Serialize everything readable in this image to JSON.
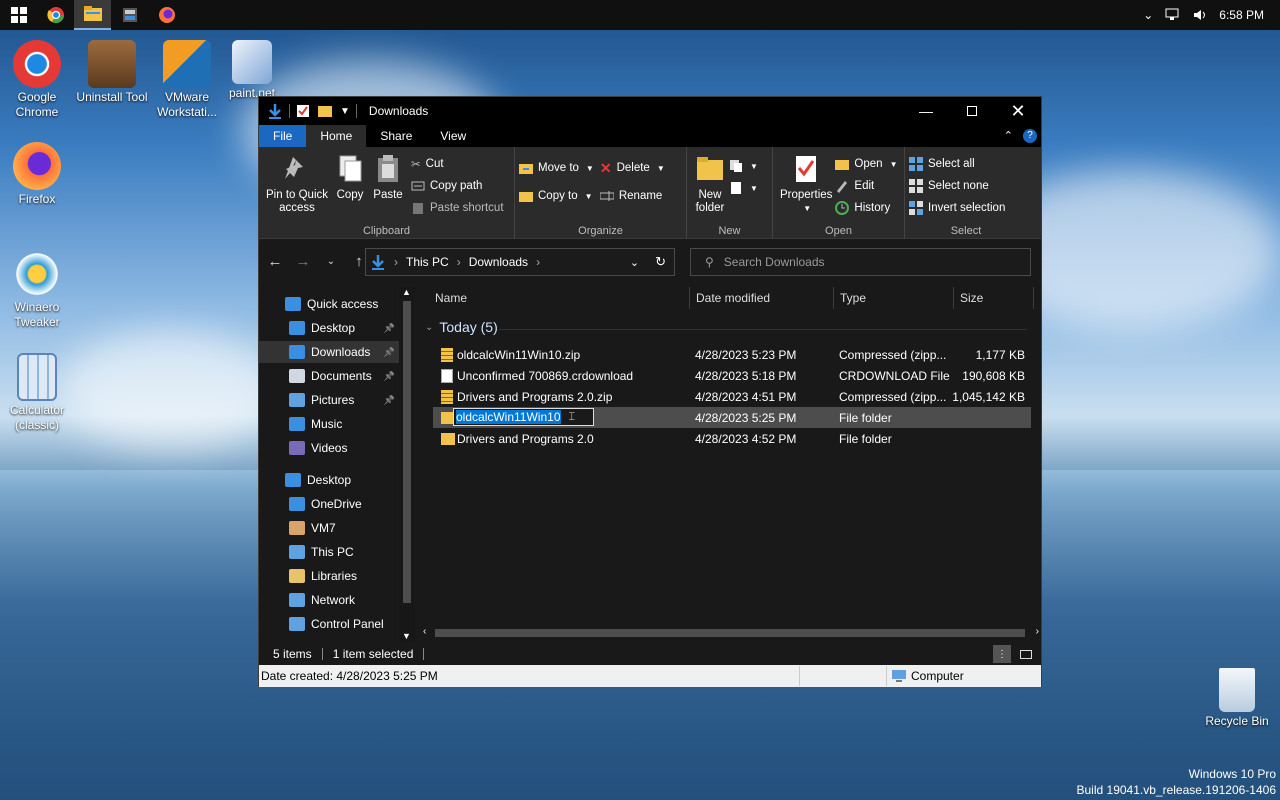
{
  "taskbar": {
    "apps": [
      {
        "name": "windows-start",
        "active": false
      },
      {
        "name": "chrome",
        "active": false
      },
      {
        "name": "file-explorer",
        "active": true
      },
      {
        "name": "uninstall-tool",
        "active": false
      },
      {
        "name": "firefox",
        "active": false
      }
    ],
    "clock": "6:58 PM"
  },
  "desktop": {
    "icons": [
      {
        "label": "Google\nChrome",
        "icon": "chrome-icon",
        "color": "#e53935"
      },
      {
        "label": "Uninstall Tool",
        "icon": "uninstall-tool-icon",
        "color": "#6d4c41"
      },
      {
        "label": "VMware\nWorkstati...",
        "icon": "vmware-icon",
        "color": "#1f6fb5"
      },
      {
        "label": "paint.net",
        "icon": "paintnet-icon",
        "color": "#9fb6d8"
      },
      {
        "label": "Firefox",
        "icon": "firefox-icon",
        "color": "#ff7139"
      },
      {
        "label": "Winaero\nTweaker",
        "icon": "winaero-icon",
        "color": "#2f9bd6"
      },
      {
        "label": "Calculator\n(classic)",
        "icon": "calculator-icon",
        "color": "#8fb7dd"
      },
      {
        "label": "Recycle Bin",
        "icon": "recycle-bin-icon",
        "color": "#d9e6f2"
      }
    ],
    "watermark": {
      "line1": "Windows 10 Pro",
      "line2": "Build 19041.vb_release.191206-1406"
    }
  },
  "window": {
    "title": "Downloads",
    "tabs": [
      "File",
      "Home",
      "Share",
      "View"
    ],
    "ribbon": {
      "clipboard": {
        "label": "Clipboard",
        "pin": "Pin to Quick\naccess",
        "copy": "Copy",
        "paste": "Paste",
        "cut": "Cut",
        "copy_path": "Copy path",
        "paste_shortcut": "Paste shortcut"
      },
      "organize": {
        "label": "Organize",
        "move_to": "Move to",
        "copy_to": "Copy to",
        "delete": "Delete",
        "rename": "Rename"
      },
      "new": {
        "label": "New",
        "new_folder": "New\nfolder"
      },
      "open": {
        "label": "Open",
        "properties": "Properties",
        "open": "Open",
        "edit": "Edit",
        "history": "History"
      },
      "select": {
        "label": "Select",
        "select_all": "Select all",
        "select_none": "Select none",
        "invert": "Invert selection"
      }
    },
    "address": {
      "segments": [
        "This PC",
        "Downloads"
      ]
    },
    "search": {
      "placeholder": "Search Downloads"
    },
    "nav": [
      {
        "label": "Quick access",
        "icon": "star-icon",
        "color": "#3b8fe0",
        "pinned": false,
        "selected": false,
        "indent": 1
      },
      {
        "label": "Desktop",
        "icon": "desktop-icon",
        "color": "#3b8fe0",
        "pinned": true,
        "selected": false,
        "indent": 2
      },
      {
        "label": "Downloads",
        "icon": "download-icon",
        "color": "#3b8fe0",
        "pinned": true,
        "selected": true,
        "indent": 2
      },
      {
        "label": "Documents",
        "icon": "documents-icon",
        "color": "#cfd8e3",
        "pinned": true,
        "selected": false,
        "indent": 2
      },
      {
        "label": "Pictures",
        "icon": "pictures-icon",
        "color": "#5fa2df",
        "pinned": true,
        "selected": false,
        "indent": 2
      },
      {
        "label": "Music",
        "icon": "music-icon",
        "color": "#3b8fe0",
        "pinned": false,
        "selected": false,
        "indent": 2
      },
      {
        "label": "Videos",
        "icon": "videos-icon",
        "color": "#7a6bb8",
        "pinned": false,
        "selected": false,
        "indent": 2
      },
      {
        "label": "Desktop",
        "icon": "desktop-icon",
        "color": "#3b8fe0",
        "pinned": false,
        "selected": false,
        "indent": 1
      },
      {
        "label": "OneDrive",
        "icon": "onedrive-icon",
        "color": "#3b8fe0",
        "pinned": false,
        "selected": false,
        "indent": 2
      },
      {
        "label": "VM7",
        "icon": "user-icon",
        "color": "#d9a46a",
        "pinned": false,
        "selected": false,
        "indent": 2
      },
      {
        "label": "This PC",
        "icon": "computer-icon",
        "color": "#5fa2df",
        "pinned": false,
        "selected": false,
        "indent": 2
      },
      {
        "label": "Libraries",
        "icon": "libraries-icon",
        "color": "#e8c36a",
        "pinned": false,
        "selected": false,
        "indent": 2
      },
      {
        "label": "Network",
        "icon": "network-icon",
        "color": "#5fa2df",
        "pinned": false,
        "selected": false,
        "indent": 2
      },
      {
        "label": "Control Panel",
        "icon": "control-panel-icon",
        "color": "#5fa2df",
        "pinned": false,
        "selected": false,
        "indent": 2
      }
    ],
    "columns": {
      "name": "Name",
      "date": "Date modified",
      "type": "Type",
      "size": "Size"
    },
    "group": "Today (5)",
    "files": [
      {
        "name": "oldcalcWin11Win10.zip",
        "date": "4/28/2023 5:23 PM",
        "type": "Compressed (zipp...",
        "size": "1,177 KB",
        "icon": "zip-folder-icon",
        "selected": false,
        "renaming": false
      },
      {
        "name": "Unconfirmed 700869.crdownload",
        "date": "4/28/2023 5:18 PM",
        "type": "CRDOWNLOAD File",
        "size": "190,608 KB",
        "icon": "file-icon",
        "selected": false,
        "renaming": false
      },
      {
        "name": "Drivers and Programs 2.0.zip",
        "date": "4/28/2023 4:51 PM",
        "type": "Compressed (zipp...",
        "size": "1,045,142 KB",
        "icon": "zip-folder-icon",
        "selected": false,
        "renaming": false
      },
      {
        "name": "oldcalcWin11Win10",
        "date": "4/28/2023 5:25 PM",
        "type": "File folder",
        "size": "",
        "icon": "folder-icon",
        "selected": true,
        "renaming": true
      },
      {
        "name": "Drivers and Programs 2.0",
        "date": "4/28/2023 4:52 PM",
        "type": "File folder",
        "size": "",
        "icon": "folder-icon",
        "selected": false,
        "renaming": false
      }
    ],
    "status": {
      "items": "5 items",
      "selected": "1 item selected"
    },
    "details": {
      "created": "Date created: 4/28/2023 5:25 PM",
      "location": "Computer"
    }
  }
}
